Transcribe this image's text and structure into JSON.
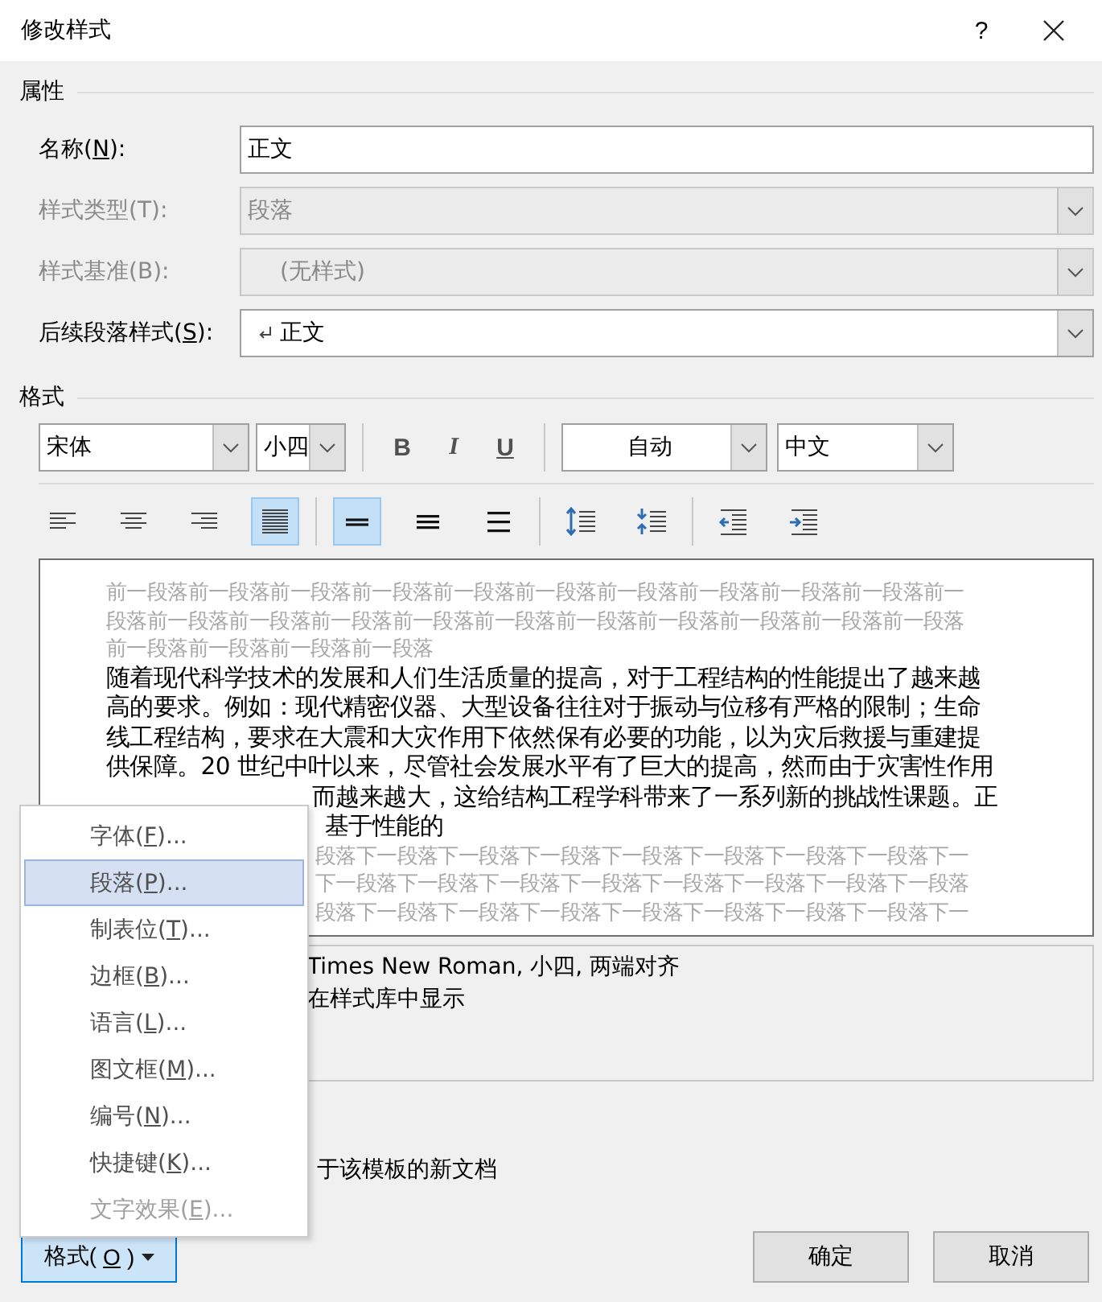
{
  "window": {
    "title": "修改样式",
    "help": "?"
  },
  "properties": {
    "heading": "属性",
    "fields": [
      {
        "kind": "text",
        "label": [
          "名称(",
          "N",
          "):"
        ],
        "value": "正文",
        "disabled": false
      },
      {
        "kind": "select",
        "label": [
          "样式类型(T):"
        ],
        "value": "段落",
        "disabled": true
      },
      {
        "kind": "select",
        "label": [
          "样式基准(B):"
        ],
        "value": "(无样式)",
        "disabled": true
      },
      {
        "kind": "select",
        "label": [
          "后续段落样式(",
          "S",
          "):"
        ],
        "value": "正文",
        "disabled": false,
        "paragraph_mark": true
      }
    ]
  },
  "format": {
    "heading": "格式",
    "font": "宋体",
    "size": "小四",
    "styles": [
      {
        "kind": "bold",
        "label": "B"
      },
      {
        "kind": "italic",
        "label": "I"
      },
      {
        "kind": "underline",
        "label": "U"
      }
    ],
    "font_color": "自动",
    "language": "中文",
    "paragraph_buttons": [
      {
        "kind": "align-left",
        "selected": false
      },
      {
        "kind": "align-center",
        "selected": false
      },
      {
        "kind": "align-right",
        "selected": false
      },
      {
        "kind": "justify",
        "selected": true
      },
      {
        "kind": "single-spacing",
        "selected": true
      },
      {
        "kind": "one-half-spacing",
        "selected": false
      },
      {
        "kind": "double-spacing",
        "selected": false
      },
      {
        "kind": "increase-spacing",
        "selected": false
      },
      {
        "kind": "decrease-spacing",
        "selected": false
      },
      {
        "kind": "outdent",
        "selected": false
      },
      {
        "kind": "indent",
        "selected": false
      }
    ]
  },
  "preview": {
    "previous_lines": [
      "前一段落前一段落前一段落前一段落前一段落前一段落前一段落前一段落前一段落前一段落前一",
      "段落前一段落前一段落前一段落前一段落前一段落前一段落前一段落前一段落前一段落前一段落",
      "前一段落前一段落前一段落前一段落"
    ],
    "lines": [
      "随着现代科学技术的发展和人们生活质量的提高，对于工程结构的性能提出了越来越",
      "高的要求。例如：现代精密仪器、大型设备往往对于振动与位移有严格的限制；生命",
      "线工程结构，要求在大震和大灾作用下依然保有必要的功能，以为灾后救援与重建提",
      "供保障。20 世纪中叶以来，尽管社会发展水平有了巨大的提高，然而由于灾害性作用",
      "而越来越大，这给结构工程学科带来了一系列新的挑战性课题。正",
      "基于性能的"
    ],
    "next_lines": [
      "段落下一段落下一段落下一段落下一段落下一段落下一段落下一段落下一",
      "下一段落下一段落下一段落下一段落下一段落下一段落下一段落下一段落",
      "段落下一段落下一段落下一段落下一段落下一段落下一段落下一段落下一"
    ]
  },
  "description": [
    "Times New Roman, 小四, 两端对齐",
    "在样式库中显示"
  ],
  "template_option": "于该模板的新文档",
  "format_menu": {
    "expanded": true,
    "label": [
      "格式(",
      "O",
      ")"
    ],
    "items": [
      {
        "label": [
          "字体(",
          "F",
          ")..."
        ],
        "selected": false,
        "disabled": false
      },
      {
        "label": [
          "段落(",
          "P",
          ")..."
        ],
        "selected": true,
        "disabled": false
      },
      {
        "label": [
          "制表位(",
          "T",
          ")..."
        ],
        "selected": false,
        "disabled": false
      },
      {
        "label": [
          "边框(",
          "B",
          ")..."
        ],
        "selected": false,
        "disabled": false
      },
      {
        "label": [
          "语言(",
          "L",
          ")..."
        ],
        "selected": false,
        "disabled": false
      },
      {
        "label": [
          "图文框(",
          "M",
          ")..."
        ],
        "selected": false,
        "disabled": false
      },
      {
        "label": [
          "编号(",
          "N",
          ")..."
        ],
        "selected": false,
        "disabled": false
      },
      {
        "label": [
          "快捷键(",
          "K",
          ")..."
        ],
        "selected": false,
        "disabled": false
      },
      {
        "label": [
          "文字效果(",
          "E",
          ")..."
        ],
        "selected": false,
        "disabled": true
      }
    ]
  },
  "buttons": [
    "确定",
    "取消"
  ]
}
